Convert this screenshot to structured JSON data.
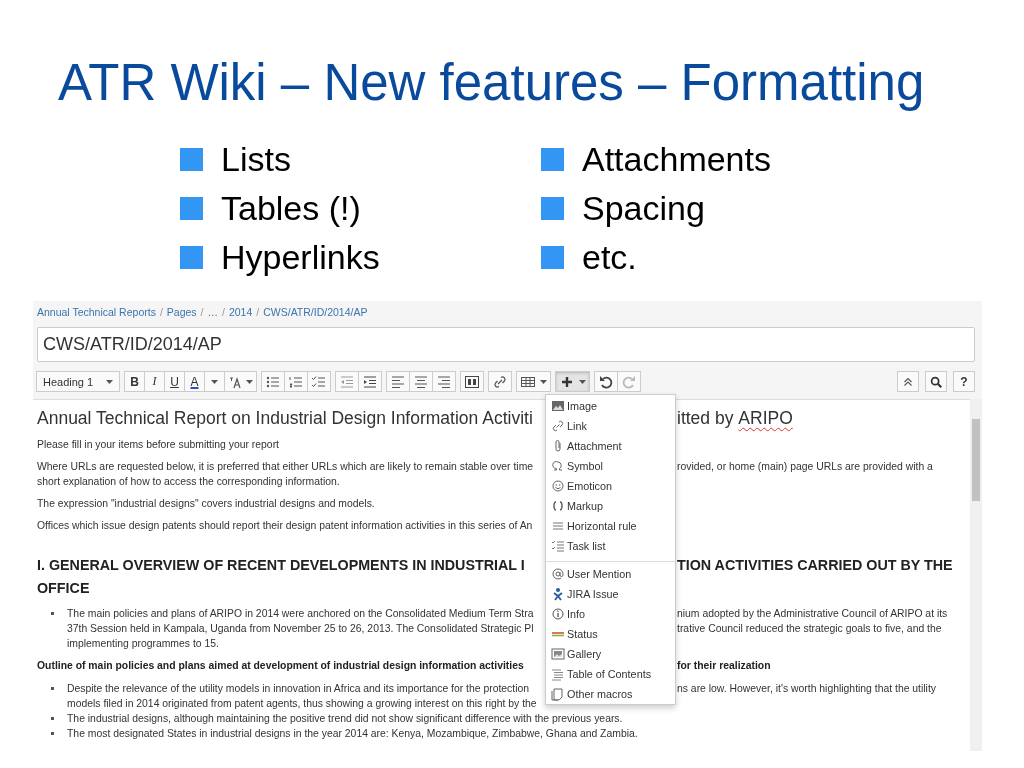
{
  "slide": {
    "title": "ATR Wiki – New features – Formatting",
    "bullets": [
      {
        "text": "Lists"
      },
      {
        "text": "Tables (!)"
      },
      {
        "text": "Hyperlinks"
      },
      {
        "text": "Attachments"
      },
      {
        "text": "Spacing"
      },
      {
        "text": "etc."
      }
    ]
  },
  "editor": {
    "breadcrumb": [
      {
        "kind": "link",
        "text": "Annual Technical Reports"
      },
      {
        "kind": "sep",
        "text": "/"
      },
      {
        "kind": "link",
        "text": "Pages"
      },
      {
        "kind": "sep",
        "text": "/"
      },
      {
        "kind": "link",
        "text": "…"
      },
      {
        "kind": "sep",
        "text": "/"
      },
      {
        "kind": "link",
        "text": "2014"
      },
      {
        "kind": "sep",
        "text": "/"
      },
      {
        "kind": "link",
        "text": "CWS/ATR/ID/2014/AP"
      }
    ],
    "page_title": "CWS/ATR/ID/2014/AP",
    "toolbar": {
      "style": "Heading 1",
      "bold": "B",
      "italic": "I",
      "underline": "U",
      "text_color": "A",
      "help": "?",
      "insert_open": true,
      "redo_disabled": true
    },
    "insert_menu": [
      {
        "label": "Image",
        "divider_above": false
      },
      {
        "label": "Link",
        "divider_above": false
      },
      {
        "label": "Attachment",
        "divider_above": false
      },
      {
        "label": "Symbol",
        "divider_above": false
      },
      {
        "label": "Emoticon",
        "divider_above": false
      },
      {
        "label": "Markup",
        "divider_above": false
      },
      {
        "label": "Horizontal rule",
        "divider_above": false
      },
      {
        "label": "Task list",
        "divider_above": false
      },
      {
        "label": "User Mention",
        "divider_above": true
      },
      {
        "label": "JIRA Issue",
        "divider_above": false
      },
      {
        "label": "Info",
        "divider_above": false
      },
      {
        "label": "Status",
        "divider_above": false
      },
      {
        "label": "Gallery",
        "divider_above": false
      },
      {
        "label": "Table of Contents",
        "divider_above": false
      },
      {
        "label": "Other macros",
        "divider_above": false
      }
    ],
    "document": [
      {
        "kind": "title",
        "left": "Annual Technical Report on Industrial Design Information Activiti",
        "right": "itted by",
        "misspelled": "ARIPO"
      },
      {
        "kind": "para",
        "left": "Please fill in your items before submitting your report"
      },
      {
        "kind": "para",
        "left": "Where URLs are requested below, it is preferred that either URLs which are likely to remain stable over time",
        "right": "rovided, or home (main) page URLs are provided with a"
      },
      {
        "kind": "para_cont",
        "left": "short explanation of how to access the corresponding information."
      },
      {
        "kind": "para",
        "left": "The expression \"industrial designs\" covers industrial designs and models."
      },
      {
        "kind": "para",
        "left": "Offices which issue design patents should report their design patent information activities in this series of An"
      },
      {
        "kind": "section",
        "left": "I. GENERAL OVERVIEW OF RECENT DEVELOPMENTS IN INDUSTRIAL I",
        "right": "TION ACTIVITIES CARRIED OUT BY THE"
      },
      {
        "kind": "section_cont",
        "left": "OFFICE"
      },
      {
        "kind": "bullet",
        "left": "The main policies and plans of ARIPO in 2014 were anchored on the Consolidated Medium Term Stra",
        "right": "nium adopted by the Administrative Council of ARIPO at its"
      },
      {
        "kind": "bullet_cont",
        "left": "37th Session held in Kampala, Uganda from November 25 to 26, 2013. The Consolidated Strategic Pl",
        "right": "trative Council reduced the strategic goals to five, and the"
      },
      {
        "kind": "bullet_cont",
        "left": "implementing programmes to 15."
      },
      {
        "kind": "bold",
        "left": "Outline of main policies and plans aimed at development of industrial design information activities",
        "right": "for their realization"
      },
      {
        "kind": "bullet",
        "left": "Despite the relevance of the utility models in innovation in Africa and its importance for the protection",
        "right": "ns are low. However, it's worth highlighting that the utility"
      },
      {
        "kind": "bullet_cont",
        "left": "models filed in 2014 originated from patent agents, thus showing a growing interest on this right by the"
      },
      {
        "kind": "bullet",
        "left": "The industrial designs, although maintaining the positive trend did not show significant difference with the previous years."
      },
      {
        "kind": "bullet",
        "left": "The most designated States in industrial designs in the year 2014 are: Kenya, Mozambique, Zimbabwe, Ghana and Zambia."
      }
    ]
  }
}
